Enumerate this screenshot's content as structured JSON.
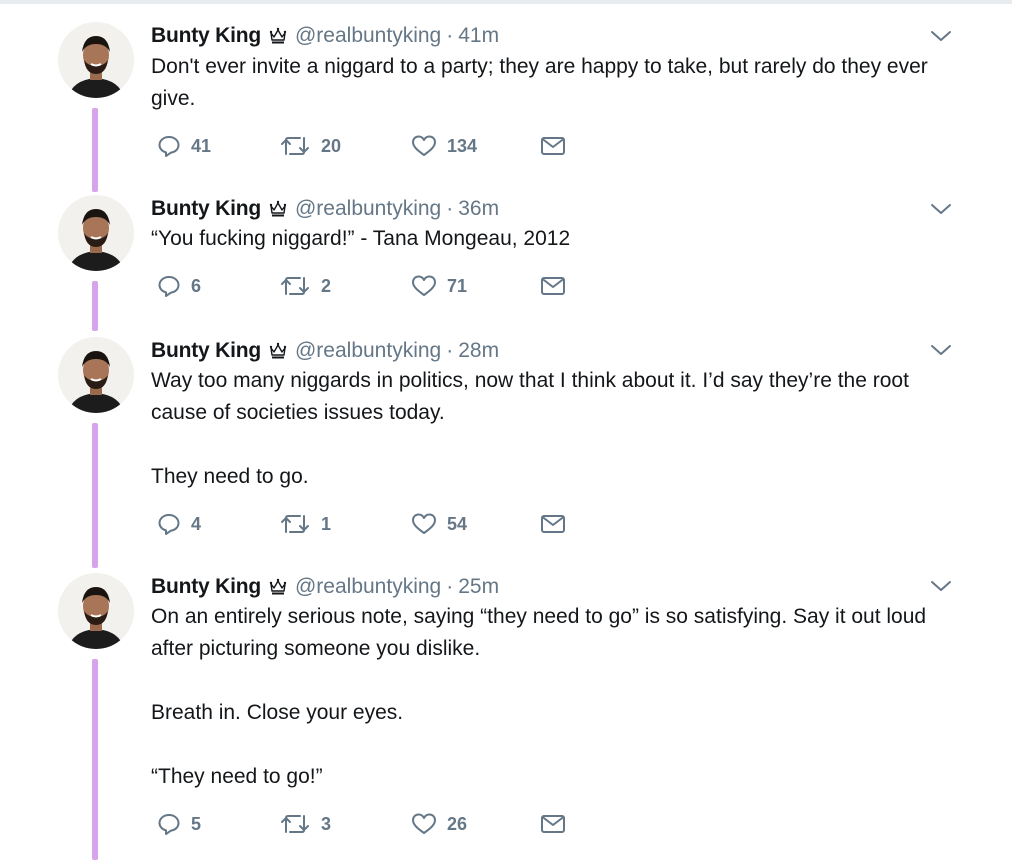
{
  "tweets": [
    {
      "name": "Bunty King",
      "handle": "@realbuntyking",
      "separator": "·",
      "time": "41m",
      "paragraphs": [
        "Don't ever invite a niggard to a party; they are happy to take, but rarely do they ever give."
      ],
      "replies": "41",
      "retweets": "20",
      "likes": "134"
    },
    {
      "name": "Bunty King",
      "handle": "@realbuntyking",
      "separator": "·",
      "time": "36m",
      "paragraphs": [
        "“You fucking niggard!” - Tana Mongeau, 2012"
      ],
      "replies": "6",
      "retweets": "2",
      "likes": "71"
    },
    {
      "name": "Bunty King",
      "handle": "@realbuntyking",
      "separator": "·",
      "time": "28m",
      "paragraphs": [
        "Way too many niggards in politics, now that I think about it. I’d say they’re the root cause of societies issues today.",
        "They need to go."
      ],
      "replies": "4",
      "retweets": "1",
      "likes": "54"
    },
    {
      "name": "Bunty King",
      "handle": "@realbuntyking",
      "separator": "·",
      "time": "25m",
      "paragraphs": [
        "On an entirely serious note, saying “they need to go” is so satisfying. Say it out loud after picturing someone you dislike.",
        "Breath in. Close your eyes.",
        "“They need to go!”"
      ],
      "replies": "5",
      "retweets": "3",
      "likes": "26"
    }
  ],
  "icons": {
    "reply": "reply-icon",
    "retweet": "retweet-icon",
    "like": "heart-icon",
    "dm": "envelope-icon",
    "badge": "crown-icon",
    "caret": "chevron-down-icon"
  },
  "colors": {
    "thread_line": "#d7a4ec",
    "secondary_text": "#657786",
    "primary_text": "#14171a"
  }
}
